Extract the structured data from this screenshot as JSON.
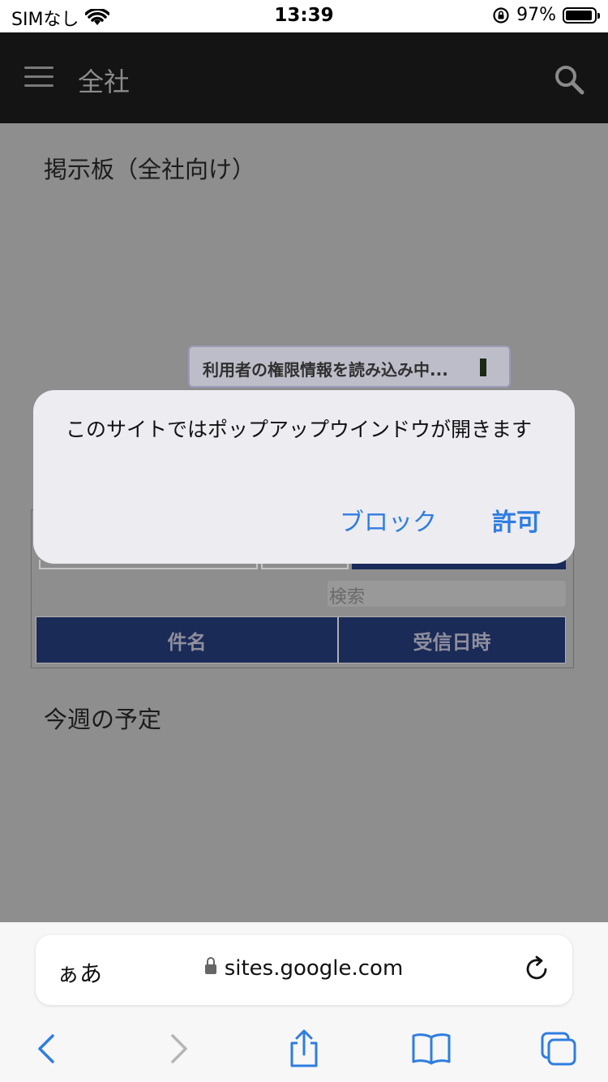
{
  "status_bar": {
    "carrier": "SIMなし",
    "time": "13:39",
    "battery_percent": "97%"
  },
  "header": {
    "title": "全社",
    "icons": [
      "hamburger-menu-icon",
      "search-icon"
    ]
  },
  "main": {
    "board_title": "掲示板（全社向け）",
    "loading_text": "利用者の権限情報を読み込み中...",
    "search_placeholder": "検索",
    "table": {
      "columns": [
        "件名",
        "受信日時"
      ]
    },
    "schedule_title": "今週の予定"
  },
  "dialog": {
    "message": "このサイトではポップアップウインドウが開きます",
    "block_label": "ブロック",
    "allow_label": "許可"
  },
  "browser": {
    "aa_label": "ぁあ",
    "url": "sites.google.com",
    "icons": [
      "lock-icon",
      "reload-icon",
      "back-icon",
      "forward-icon",
      "share-icon",
      "bookmarks-icon",
      "tabs-icon"
    ]
  },
  "colors": {
    "accent": "#2f7de1",
    "header_bg": "#141414",
    "table_header_bg": "#1b2b58"
  }
}
